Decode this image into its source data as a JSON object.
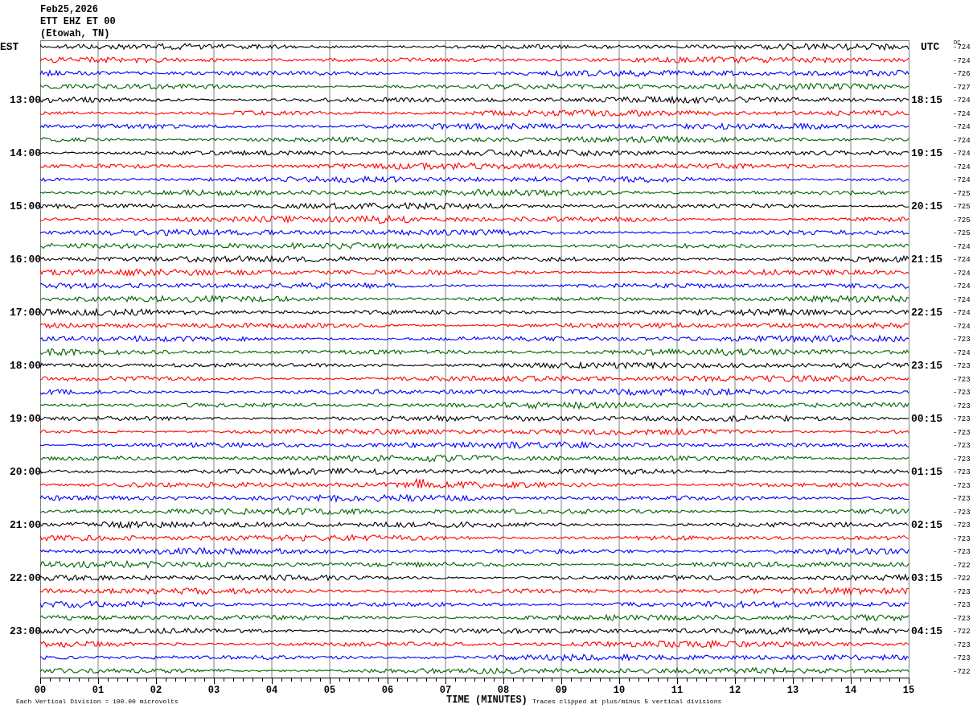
{
  "header": [
    "Feb25,2026",
    "ETT EHZ ET 00",
    "(Etowah, TN)"
  ],
  "left_header": "EST",
  "right_header": "UTC",
  "dc_header": "DC",
  "rows": [
    {
      "color": "#000000",
      "dc": "-724"
    },
    {
      "color": "#ff0000",
      "dc": "-724"
    },
    {
      "color": "#0000ff",
      "dc": "-726"
    },
    {
      "color": "#006400",
      "dc": "-727"
    },
    {
      "color": "#000000",
      "dc": "-724",
      "left": "13:00",
      "right": "18:15"
    },
    {
      "color": "#ff0000",
      "dc": "-724"
    },
    {
      "color": "#0000ff",
      "dc": "-724"
    },
    {
      "color": "#006400",
      "dc": "-724"
    },
    {
      "color": "#000000",
      "dc": "-724",
      "left": "14:00",
      "right": "19:15"
    },
    {
      "color": "#ff0000",
      "dc": "-724"
    },
    {
      "color": "#0000ff",
      "dc": "-724"
    },
    {
      "color": "#006400",
      "dc": "-725"
    },
    {
      "color": "#000000",
      "dc": "-725",
      "left": "15:00",
      "right": "20:15"
    },
    {
      "color": "#ff0000",
      "dc": "-725"
    },
    {
      "color": "#0000ff",
      "dc": "-725"
    },
    {
      "color": "#006400",
      "dc": "-724"
    },
    {
      "color": "#000000",
      "dc": "-724",
      "left": "16:00",
      "right": "21:15"
    },
    {
      "color": "#ff0000",
      "dc": "-724"
    },
    {
      "color": "#0000ff",
      "dc": "-724"
    },
    {
      "color": "#006400",
      "dc": "-724"
    },
    {
      "color": "#000000",
      "dc": "-724",
      "left": "17:00",
      "right": "22:15"
    },
    {
      "color": "#ff0000",
      "dc": "-724"
    },
    {
      "color": "#0000ff",
      "dc": "-723"
    },
    {
      "color": "#006400",
      "dc": "-724"
    },
    {
      "color": "#000000",
      "dc": "-723",
      "left": "18:00",
      "right": "23:15"
    },
    {
      "color": "#ff0000",
      "dc": "-723"
    },
    {
      "color": "#0000ff",
      "dc": "-723"
    },
    {
      "color": "#006400",
      "dc": "-723"
    },
    {
      "color": "#000000",
      "dc": "-723",
      "left": "19:00",
      "right": "00:15"
    },
    {
      "color": "#ff0000",
      "dc": "-723"
    },
    {
      "color": "#0000ff",
      "dc": "-723"
    },
    {
      "color": "#006400",
      "dc": "-723"
    },
    {
      "color": "#000000",
      "dc": "-723",
      "left": "20:00",
      "right": "01:15"
    },
    {
      "color": "#ff0000",
      "dc": "-723"
    },
    {
      "color": "#0000ff",
      "dc": "-723"
    },
    {
      "color": "#006400",
      "dc": "-723"
    },
    {
      "color": "#000000",
      "dc": "-723",
      "left": "21:00",
      "right": "02:15"
    },
    {
      "color": "#ff0000",
      "dc": "-723"
    },
    {
      "color": "#0000ff",
      "dc": "-723"
    },
    {
      "color": "#006400",
      "dc": "-722"
    },
    {
      "color": "#000000",
      "dc": "-722",
      "left": "22:00",
      "right": "03:15"
    },
    {
      "color": "#ff0000",
      "dc": "-723"
    },
    {
      "color": "#0000ff",
      "dc": "-723"
    },
    {
      "color": "#006400",
      "dc": "-723"
    },
    {
      "color": "#000000",
      "dc": "-722",
      "left": "23:00",
      "right": "04:15"
    },
    {
      "color": "#ff0000",
      "dc": "-723"
    },
    {
      "color": "#0000ff",
      "dc": "-723"
    },
    {
      "color": "#006400",
      "dc": "-722"
    }
  ],
  "x_tick_labels": [
    "00",
    "01",
    "02",
    "03",
    "04",
    "05",
    "06",
    "07",
    "08",
    "09",
    "10",
    "11",
    "12",
    "13",
    "14",
    "15"
  ],
  "x_axis_title": "TIME (MINUTES)",
  "footer_left": "Each Vertical Division =  100.00 microvolts",
  "footer_right": "Traces clipped at plus/minus 5 vertical divisions"
}
